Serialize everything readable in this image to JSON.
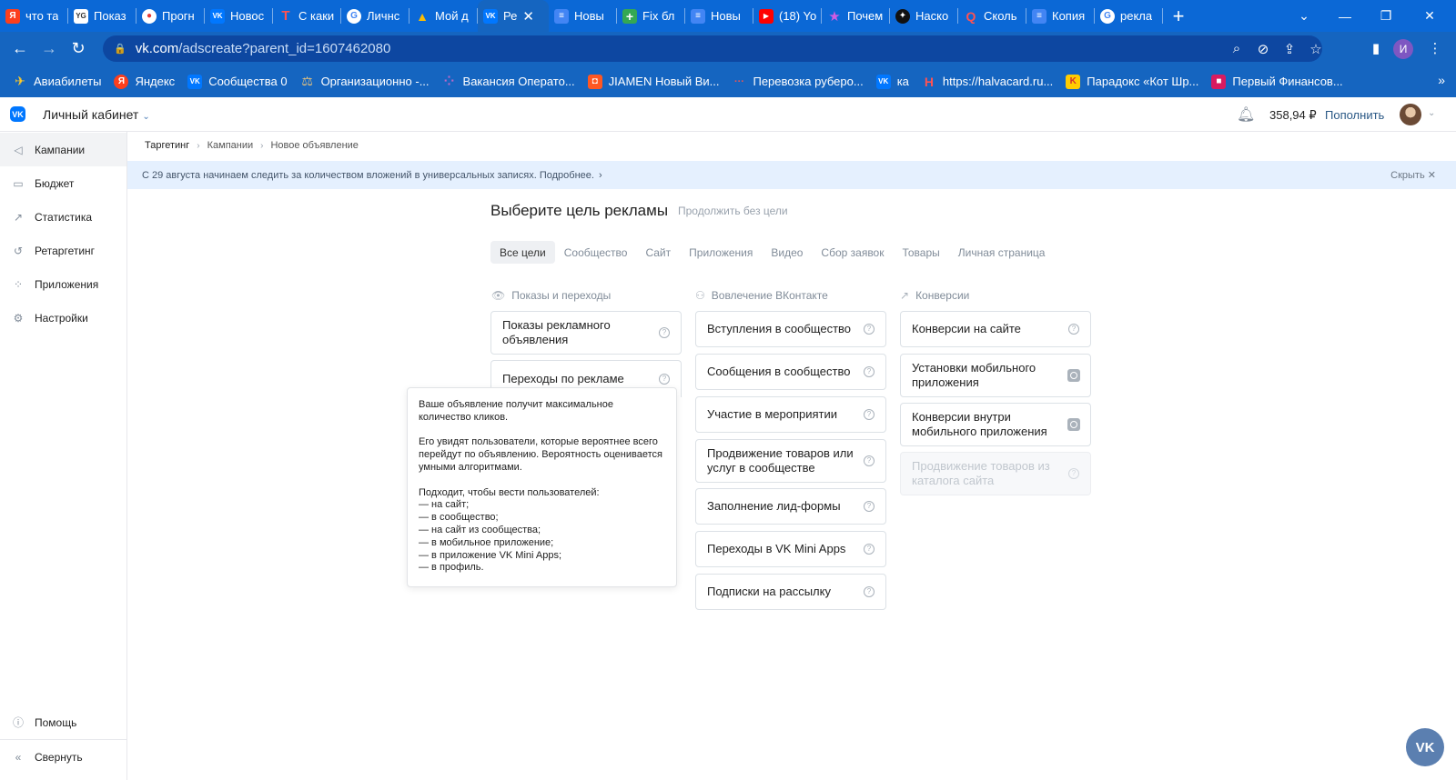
{
  "browser": {
    "tabs": [
      {
        "title": "что та",
        "favicon": "yandex-icon",
        "color": "#fc3f1d",
        "glyph": "Я"
      },
      {
        "title": "Показ",
        "favicon": "page-icon",
        "color": "#ffffff",
        "glyph": "YG"
      },
      {
        "title": "Прогн",
        "favicon": "weather-icon",
        "color": "#e53935",
        "glyph": "●"
      },
      {
        "title": "Новос",
        "favicon": "vk-icon",
        "color": "#0077ff",
        "glyph": "VK"
      },
      {
        "title": "С каки",
        "favicon": "t-icon",
        "color": "#e53935",
        "glyph": "T"
      },
      {
        "title": "Личнс",
        "favicon": "google-icon",
        "color": "#ffffff",
        "glyph": "G"
      },
      {
        "title": "Мой д",
        "favicon": "drive-icon",
        "color": "#fbbc04",
        "glyph": "▲"
      },
      {
        "title": "Ре",
        "favicon": "vk-icon",
        "color": "#0077ff",
        "glyph": "VK",
        "active": true
      },
      {
        "title": "Новы",
        "favicon": "docs-icon",
        "color": "#4285f4",
        "glyph": "≡"
      },
      {
        "title": "Fix бл",
        "favicon": "plus-icon",
        "color": "#34a853",
        "glyph": "+"
      },
      {
        "title": "Новы",
        "favicon": "docs-icon",
        "color": "#4285f4",
        "glyph": "≡"
      },
      {
        "title": "(18) Yo",
        "favicon": "youtube-icon",
        "color": "#ff0000",
        "glyph": "▶"
      },
      {
        "title": "Почем",
        "favicon": "star-icon",
        "color": "#ab47bc",
        "glyph": "★"
      },
      {
        "title": "Наско",
        "favicon": "compass-icon",
        "color": "#111111",
        "glyph": "✦"
      },
      {
        "title": "Сколь",
        "favicon": "q-icon",
        "color": "#e53935",
        "glyph": "Q"
      },
      {
        "title": "Копия",
        "favicon": "docs-icon",
        "color": "#4285f4",
        "glyph": "≡"
      },
      {
        "title": "рекла",
        "favicon": "google-icon",
        "color": "#ffffff",
        "glyph": "G"
      }
    ],
    "url_host": "vk.com",
    "url_path": "/adscreate?parent_id=1607462080",
    "profile_initial": "И",
    "bookmarks": [
      {
        "label": "Авиабилеты",
        "color": "#ffb300",
        "glyph": "✈"
      },
      {
        "label": "Яндекс",
        "color": "#fc3f1d",
        "glyph": "Я"
      },
      {
        "label": "Сообщества 0",
        "color": "#0077ff",
        "glyph": "VK"
      },
      {
        "label": "Организационно -...",
        "color": "#c0a060",
        "glyph": "⚖"
      },
      {
        "label": "Вакансия Операто...",
        "color": "#8e44ad",
        "glyph": "●"
      },
      {
        "label": "JIAMEN Новый Ви...",
        "color": "#ff5722",
        "glyph": "◘"
      },
      {
        "label": "Перевозка руберо...",
        "color": "#e53935",
        "glyph": "···"
      },
      {
        "label": "ка",
        "color": "#0077ff",
        "glyph": "VK"
      },
      {
        "label": "https://halvacard.ru...",
        "color": "#e53935",
        "glyph": "H"
      },
      {
        "label": "Парадокс «Кот Шр...",
        "color": "#ffcc00",
        "glyph": "K"
      },
      {
        "label": "Первый Финансов...",
        "color": "#d81b60",
        "glyph": "■"
      }
    ],
    "bookmarks_more": "»"
  },
  "header": {
    "cabinet_label": "Личный кабинет",
    "balance": "358,94 ₽",
    "topup_label": "Пополнить"
  },
  "sidebar": {
    "items": [
      {
        "label": "Кампании",
        "icon": "megaphone-icon",
        "glyph": "◁"
      },
      {
        "label": "Бюджет",
        "icon": "wallet-icon",
        "glyph": "▭"
      },
      {
        "label": "Статистика",
        "icon": "chart-icon",
        "glyph": "↗"
      },
      {
        "label": "Ретаргетинг",
        "icon": "retarget-icon",
        "glyph": "↺"
      },
      {
        "label": "Приложения",
        "icon": "apps-icon",
        "glyph": "⁘"
      },
      {
        "label": "Настройки",
        "icon": "gear-icon",
        "glyph": "⚙"
      }
    ],
    "help_label": "Помощь",
    "collapse_label": "Свернуть"
  },
  "breadcrumb": [
    "Таргетинг",
    "Кампании",
    "Новое объявление"
  ],
  "notice": {
    "text": "С 29 августа начинаем следить за количеством вложений в универсальных записях. Подробнее.",
    "hide_label": "Скрыть"
  },
  "main": {
    "title": "Выберите цель рекламы",
    "skip_label": "Продолжить без цели",
    "filters": [
      "Все цели",
      "Сообщество",
      "Сайт",
      "Приложения",
      "Видео",
      "Сбор заявок",
      "Товары",
      "Личная страница"
    ],
    "columns": [
      {
        "heading": "Показы и переходы",
        "icon": "eye-icon",
        "cards": [
          "Показы рекламного объявления",
          "Переходы по рекламе"
        ]
      },
      {
        "heading": "Вовлечение ВКонтакте",
        "icon": "users-icon",
        "cards": [
          "Вступления в сообщество",
          "Сообщения в сообщество",
          "Участие в мероприятии",
          "Продвижение товаров или услуг в сообществе",
          "Заполнение лид-формы",
          "Переходы в VK Mini Apps",
          "Подписки на рассылку"
        ]
      },
      {
        "heading": "Конверсии",
        "icon": "trend-icon",
        "cards": [
          "Конверсии на сайте",
          "Установки мобильного приложения",
          "Конверсии внутри мобильного приложения",
          "Продвижение товаров из каталога сайта"
        ]
      }
    ],
    "tooltip": {
      "p1": "Ваше объявление получит максимальное количество кликов.",
      "p2": "Его увидят пользователи, которые вероятнее всего перейдут по объявлению. Вероятность оценивается умными алгоритмами.",
      "p3_title": "Подходит, чтобы вести пользователей:",
      "p3_items": [
        "— на сайт;",
        "— в сообщество;",
        "— на сайт из сообщества;",
        "— в мобильное приложение;",
        "— в приложение VK Mini Apps;",
        "— в профиль."
      ]
    }
  },
  "colors": {
    "vk_blue": "#0077ff",
    "link": "#2a5885",
    "chrome": "#1565c0"
  }
}
